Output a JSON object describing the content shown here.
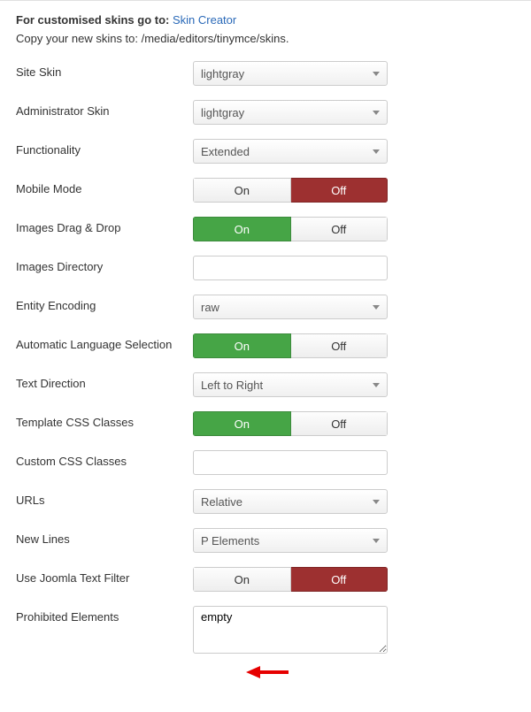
{
  "intro": {
    "prefix": "For customised skins go to: ",
    "link_text": "Skin Creator"
  },
  "copy_line": "Copy your new skins to: /media/editors/tinymce/skins.",
  "toggle_labels": {
    "on": "On",
    "off": "Off"
  },
  "fields": {
    "site_skin": {
      "label": "Site Skin",
      "value": "lightgray"
    },
    "admin_skin": {
      "label": "Administrator Skin",
      "value": "lightgray"
    },
    "functionality": {
      "label": "Functionality",
      "value": "Extended"
    },
    "mobile_mode": {
      "label": "Mobile Mode",
      "active": "off"
    },
    "images_drag": {
      "label": "Images Drag & Drop",
      "active": "on"
    },
    "images_dir": {
      "label": "Images Directory",
      "value": ""
    },
    "entity_encoding": {
      "label": "Entity Encoding",
      "value": "raw"
    },
    "auto_lang": {
      "label": "Automatic Language Selection",
      "active": "on"
    },
    "text_direction": {
      "label": "Text Direction",
      "value": "Left to Right"
    },
    "template_css": {
      "label": "Template CSS Classes",
      "active": "on"
    },
    "custom_css": {
      "label": "Custom CSS Classes",
      "value": ""
    },
    "urls": {
      "label": "URLs",
      "value": "Relative"
    },
    "new_lines": {
      "label": "New Lines",
      "value": "P Elements"
    },
    "joomla_filter": {
      "label": "Use Joomla Text Filter",
      "active": "off"
    },
    "prohibited": {
      "label": "Prohibited Elements",
      "value": "empty"
    }
  }
}
